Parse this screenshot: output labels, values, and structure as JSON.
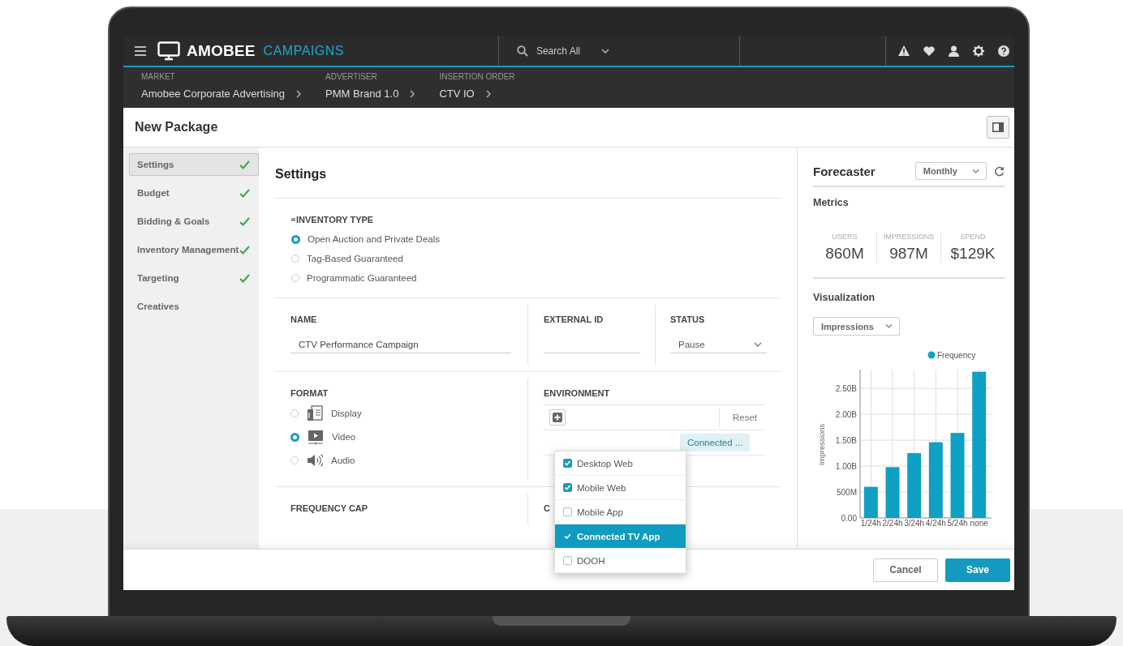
{
  "app": {
    "brand": "AMOBEE",
    "product": "CAMPAIGNS",
    "search": {
      "placeholder": "Search All"
    }
  },
  "breadcrumbs": [
    {
      "label": "MARKET",
      "value": "Amobee Corporate Advertising"
    },
    {
      "label": "ADVERTISER",
      "value": "PMM Brand 1.0"
    },
    {
      "label": "INSERTION ORDER",
      "value": "CTV IO"
    }
  ],
  "page_title": "New Package",
  "sidebar": {
    "items": [
      {
        "label": "Settings",
        "selected": true,
        "complete": true
      },
      {
        "label": "Budget",
        "selected": false,
        "complete": true
      },
      {
        "label": "Bidding & Goals",
        "selected": false,
        "complete": true
      },
      {
        "label": "Inventory Management",
        "selected": false,
        "complete": true
      },
      {
        "label": "Targeting",
        "selected": false,
        "complete": true
      },
      {
        "label": "Creatives",
        "selected": false,
        "complete": false
      }
    ]
  },
  "settings": {
    "title": "Settings",
    "inventory_type": {
      "label": "INVENTORY TYPE",
      "options": [
        {
          "label": "Open Auction and Private Deals",
          "selected": true
        },
        {
          "label": "Tag-Based Guaranteed",
          "selected": false
        },
        {
          "label": "Programmatic Guaranteed",
          "selected": false
        }
      ]
    },
    "name": {
      "label": "NAME",
      "value": "CTV Performance Campaign"
    },
    "external_id": {
      "label": "EXTERNAL ID"
    },
    "status": {
      "label": "STATUS",
      "value": "Pause"
    },
    "format": {
      "label": "FORMAT",
      "options": [
        {
          "label": "Display",
          "kind": "display",
          "selected": false
        },
        {
          "label": "Video",
          "kind": "video",
          "selected": true
        },
        {
          "label": "Audio",
          "kind": "audio",
          "selected": false
        }
      ]
    },
    "environment": {
      "label": "ENVIRONMENT",
      "reset": "Reset",
      "chips": [
        "Connected ..."
      ]
    },
    "frequency_cap": {
      "label": "FREQUENCY CAP"
    },
    "column_2": "C"
  },
  "environment_dropdown": {
    "options": [
      {
        "label": "Desktop Web",
        "checked": true,
        "selected": false
      },
      {
        "label": "Mobile Web",
        "checked": true,
        "selected": false
      },
      {
        "label": "Mobile App",
        "checked": false,
        "selected": false
      },
      {
        "label": "Connected TV App",
        "checked": true,
        "selected": true
      },
      {
        "label": "DOOH",
        "checked": false,
        "selected": false
      }
    ]
  },
  "forecaster": {
    "title": "Forecaster",
    "period": "Monthly",
    "metrics_title": "Metrics",
    "metrics": [
      {
        "label": "USERS",
        "value": "860M"
      },
      {
        "label": "IMPRESSIONS",
        "value": "987M"
      },
      {
        "label": "SPEND",
        "value": "$129K"
      }
    ],
    "visualization_title": "Visualization",
    "visualization_select": "Impressions",
    "chart_data": {
      "type": "bar",
      "ylabel": "Impressions",
      "categories": [
        "1/24h",
        "2/24h",
        "3/24h",
        "4/24h",
        "5/24h",
        "none"
      ],
      "series": [
        {
          "name": "Frequency",
          "color": "#0fa0c4",
          "values": [
            600000000,
            980000000,
            1250000000,
            1460000000,
            1640000000,
            2820000000
          ]
        }
      ],
      "ylim": [
        0,
        2830000000
      ],
      "grid": true,
      "yticks": [
        {
          "value": 0,
          "label": "0.00"
        },
        {
          "value": 500000000,
          "label": "500M"
        },
        {
          "value": 1000000000,
          "label": "1.00B"
        },
        {
          "value": 1500000000,
          "label": "1.50B"
        },
        {
          "value": 2000000000,
          "label": "2.00B"
        },
        {
          "value": 2500000000,
          "label": "2.50B"
        }
      ]
    }
  },
  "footer": {
    "cancel": "Cancel",
    "save": "Save"
  }
}
